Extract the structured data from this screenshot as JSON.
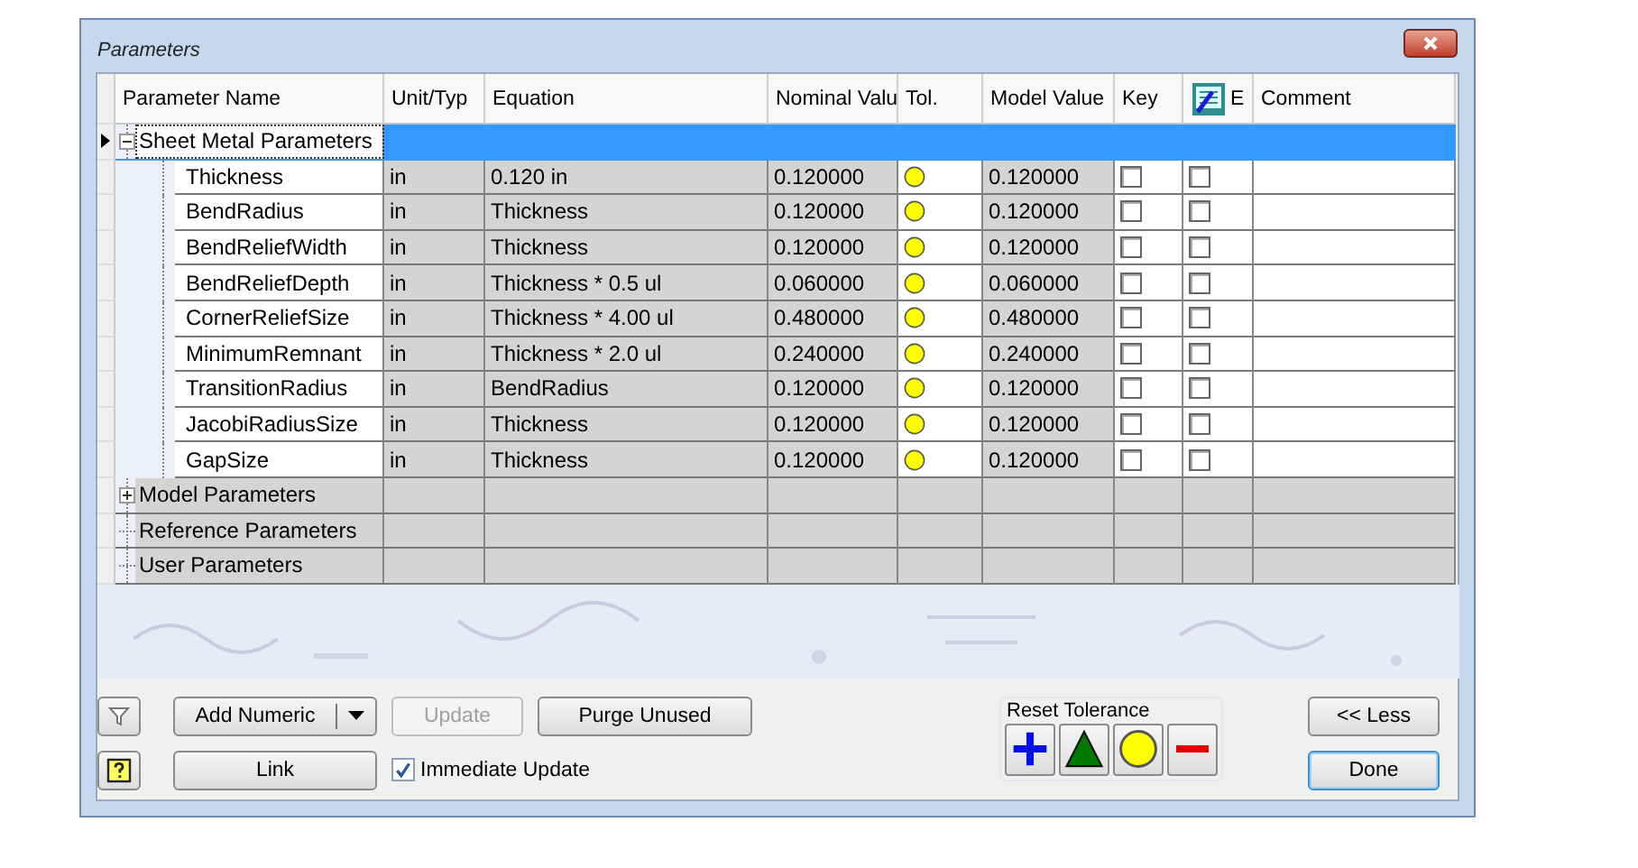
{
  "window": {
    "title": "Parameters"
  },
  "columns": [
    {
      "label": "Parameter Name"
    },
    {
      "label": "Unit/Typ"
    },
    {
      "label": "Equation"
    },
    {
      "label": "Nominal Valu"
    },
    {
      "label": "Tol."
    },
    {
      "label": "Model Value"
    },
    {
      "label": "Key"
    },
    {
      "label": "E",
      "kind": "icon"
    },
    {
      "label": "Comment"
    }
  ],
  "groups": [
    {
      "name": "Sheet Metal Parameters",
      "selected": true,
      "expandable": true,
      "expanded": true,
      "children": [
        {
          "name": "Thickness",
          "unit": "in",
          "equation": "0.120 in",
          "nominal": "0.120000",
          "kind": "nominal",
          "model_value": "0.120000",
          "key": false,
          "export": false
        },
        {
          "name": "BendRadius",
          "unit": "in",
          "equation": "Thickness",
          "nominal": "0.120000",
          "kind": "nominal",
          "model_value": "0.120000",
          "key": false,
          "export": false
        },
        {
          "name": "BendReliefWidth",
          "unit": "in",
          "equation": "Thickness",
          "nominal": "0.120000",
          "kind": "nominal",
          "model_value": "0.120000",
          "key": false,
          "export": false
        },
        {
          "name": "BendReliefDepth",
          "unit": "in",
          "equation": "Thickness * 0.5 ul",
          "nominal": "0.060000",
          "kind": "nominal",
          "model_value": "0.060000",
          "key": false,
          "export": false
        },
        {
          "name": "CornerReliefSize",
          "unit": "in",
          "equation": "Thickness * 4.00 ul",
          "nominal": "0.480000",
          "kind": "nominal",
          "model_value": "0.480000",
          "key": false,
          "export": false
        },
        {
          "name": "MinimumRemnant",
          "unit": "in",
          "equation": "Thickness * 2.0 ul",
          "nominal": "0.240000",
          "kind": "nominal",
          "model_value": "0.240000",
          "key": false,
          "export": false
        },
        {
          "name": "TransitionRadius",
          "unit": "in",
          "equation": "BendRadius",
          "nominal": "0.120000",
          "kind": "nominal",
          "model_value": "0.120000",
          "key": false,
          "export": false
        },
        {
          "name": "JacobiRadiusSize",
          "unit": "in",
          "equation": "Thickness",
          "nominal": "0.120000",
          "kind": "nominal",
          "model_value": "0.120000",
          "key": false,
          "export": false
        },
        {
          "name": "GapSize",
          "unit": "in",
          "equation": "Thickness",
          "nominal": "0.120000",
          "kind": "nominal",
          "model_value": "0.120000",
          "key": false,
          "export": false
        }
      ]
    },
    {
      "name": "Model Parameters",
      "selected": false,
      "expandable": true,
      "expanded": false
    },
    {
      "name": "Reference Parameters",
      "selected": false,
      "expandable": false
    },
    {
      "name": "User Parameters",
      "selected": false,
      "expandable": false
    }
  ],
  "buttons": {
    "add_numeric": "Add Numeric",
    "update": {
      "label": "Update",
      "disabled": true
    },
    "purge": "Purge Unused",
    "link": "Link",
    "less": "<< Less",
    "done": "Done"
  },
  "immediate_update": {
    "label": "Immediate Update",
    "checked": true
  },
  "reset_tolerance": {
    "label": "Reset Tolerance",
    "options": [
      {
        "kind": "upper"
      },
      {
        "kind": "median"
      },
      {
        "kind": "nominal"
      },
      {
        "kind": "lower"
      }
    ]
  }
}
